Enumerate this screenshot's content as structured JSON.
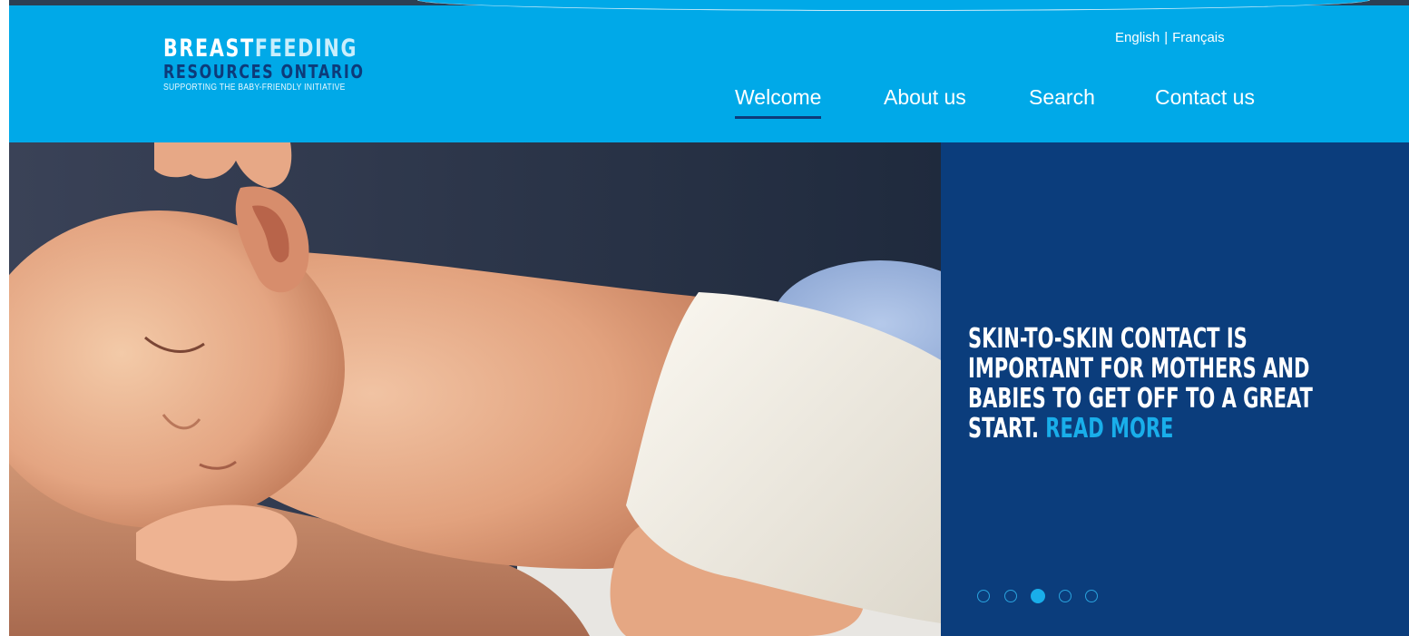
{
  "header": {
    "logo": {
      "line1_dark": "BREAST",
      "line1_light": "FEEDING",
      "line2": "RESOURCES ONTARIO",
      "tagline": "SUPPORTING THE BABY-FRIENDLY INITIATIVE"
    },
    "languages": [
      "English",
      "Français"
    ],
    "language_separator": "|",
    "nav": [
      {
        "label": "Welcome",
        "active": true
      },
      {
        "label": "About us",
        "active": false
      },
      {
        "label": "Search",
        "active": false
      },
      {
        "label": "Contact us",
        "active": false
      }
    ]
  },
  "hero": {
    "image": "sleeping-baby-skin-to-skin-photo",
    "headline": "Skin-to-skin contact is important for mothers and babies to get off to a great start.",
    "read_more": "Read more",
    "carousel": {
      "slides": 5,
      "active_index": 2
    }
  },
  "colors": {
    "header_bg": "#00a9e8",
    "panel_bg": "#0b3d7c",
    "accent_light": "#19aeea",
    "logo_dark_blue": "#0d3b7a"
  }
}
